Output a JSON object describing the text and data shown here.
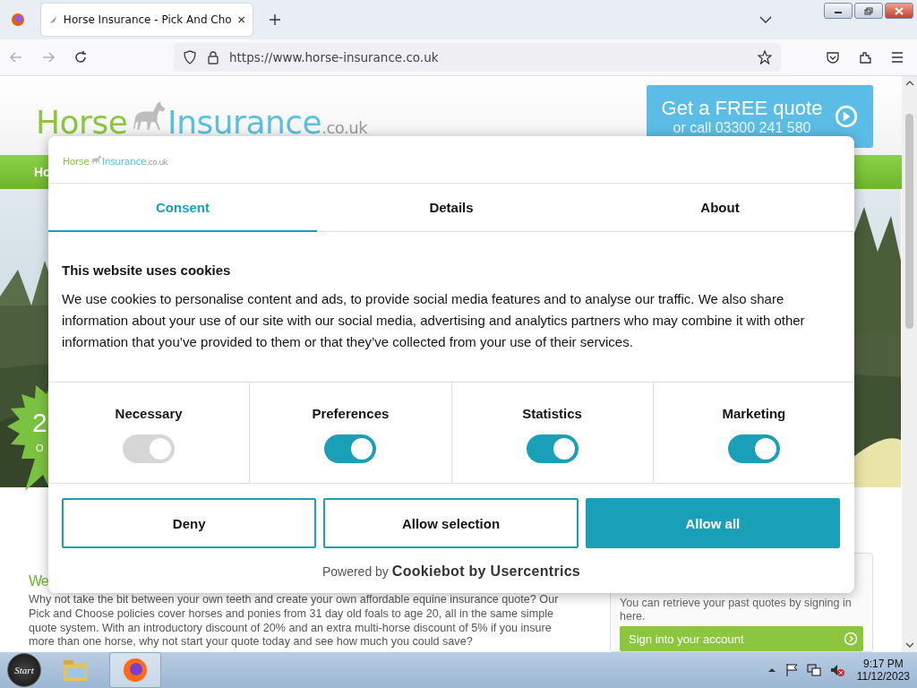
{
  "browser": {
    "tab_title": "Horse Insurance - Pick And Cho",
    "url": "https://www.horse-insurance.co.uk",
    "back_disabled": true,
    "forward_disabled": true
  },
  "site": {
    "logo": {
      "first": "Horse",
      "second": "Insurance",
      "suffix": ".co.uk"
    },
    "quote_button": {
      "title": "Get a FREE quote",
      "subtitle": "or call 03300 241 580"
    },
    "nav": [
      "Ho"
    ],
    "badge": {
      "number": "2",
      "caption": "O"
    },
    "welcome_heading": "We",
    "intro": "Why not take the bit between your own teeth and create your own affordable equine insurance quote? Our Pick and Choose policies cover horses and ponies from 31 day old foals to age 20, all in the same simple quote system. With an introductory discount of 20% and an extra multi-horse discount of 5% if you insure more than one horse, why not start your quote today and see how much you could save?",
    "account_panel": {
      "text": "You can retrieve your past quotes by signing in here.",
      "button": "Sign into your account"
    }
  },
  "cookie_dialog": {
    "logo": {
      "first": "Horse",
      "second": "Insurance",
      "suffix": ".co.uk"
    },
    "tabs": [
      {
        "label": "Consent",
        "selected": true
      },
      {
        "label": "Details",
        "selected": false
      },
      {
        "label": "About",
        "selected": false
      }
    ],
    "heading": "This website uses cookies",
    "body": "We use cookies to personalise content and ads, to provide social media features and to analyse our traffic. We also share information about your use of our site with our social media, advertising and analytics partners who may combine it with other information that you’ve provided to them or that they’ve collected from your use of their services.",
    "categories": [
      {
        "label": "Necessary",
        "checked": true,
        "disabled": true
      },
      {
        "label": "Preferences",
        "checked": true,
        "disabled": false
      },
      {
        "label": "Statistics",
        "checked": true,
        "disabled": false
      },
      {
        "label": "Marketing",
        "checked": true,
        "disabled": false
      }
    ],
    "buttons": [
      {
        "label": "Deny",
        "kind": "outline"
      },
      {
        "label": "Allow selection",
        "kind": "outline"
      },
      {
        "label": "Allow all",
        "kind": "filled"
      }
    ],
    "powered_by": {
      "prefix": "Powered by",
      "brand": "Cookiebot by Usercentrics"
    }
  },
  "taskbar": {
    "start": "Start",
    "time": "9:17 PM",
    "date": "11/12/2023"
  }
}
